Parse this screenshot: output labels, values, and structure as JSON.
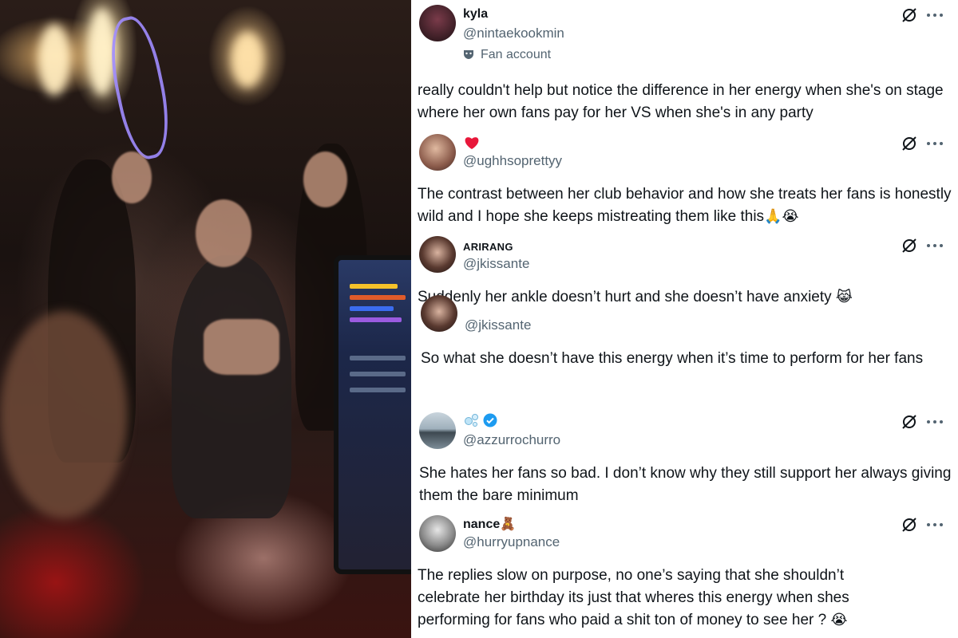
{
  "colors": {
    "text_primary": "#0f1419",
    "text_secondary": "#536471",
    "verified_blue": "#1d9bf0",
    "heart_red": "#e8173a"
  },
  "photo": {
    "description_icon": "party-photo"
  },
  "tweets": [
    {
      "name": "kyla",
      "handle": "@nintaekookmin",
      "label": "Fan account",
      "text": "really couldn't help but notice the difference in her energy when she's on stage where her own fans pay for her VS when she's in any party"
    },
    {
      "name": "",
      "handle": "@ughhsoprettyy",
      "text": "The contrast between her club behavior and how she treats her fans is honestly wild and I hope she keeps mistreating them like this",
      "emoji": "🙏😭"
    },
    {
      "name": "ARIRANG",
      "handle": "@jkissante",
      "text": "Suddenly her ankle doesn’t hurt and she doesn’t have anxiety",
      "emoji": "😹"
    },
    {
      "name": "",
      "handle": "@jkissante",
      "text": "So what she doesn’t have this energy when it’s time to perform for her fans"
    },
    {
      "name": "",
      "handle": "@azzurrochurro",
      "text": "She hates her fans so bad. I don’t know why they still support her always giving them the bare minimum"
    },
    {
      "name": "nance",
      "name_emoji": "🧸",
      "handle": "@hurryupnance",
      "text": "The replies slow on purpose, no one’s saying that she shouldn’t celebrate her birthday its just that wheres this energy when shes performing for fans who paid a shit ton of money to see her ?",
      "emoji": "😭"
    }
  ]
}
